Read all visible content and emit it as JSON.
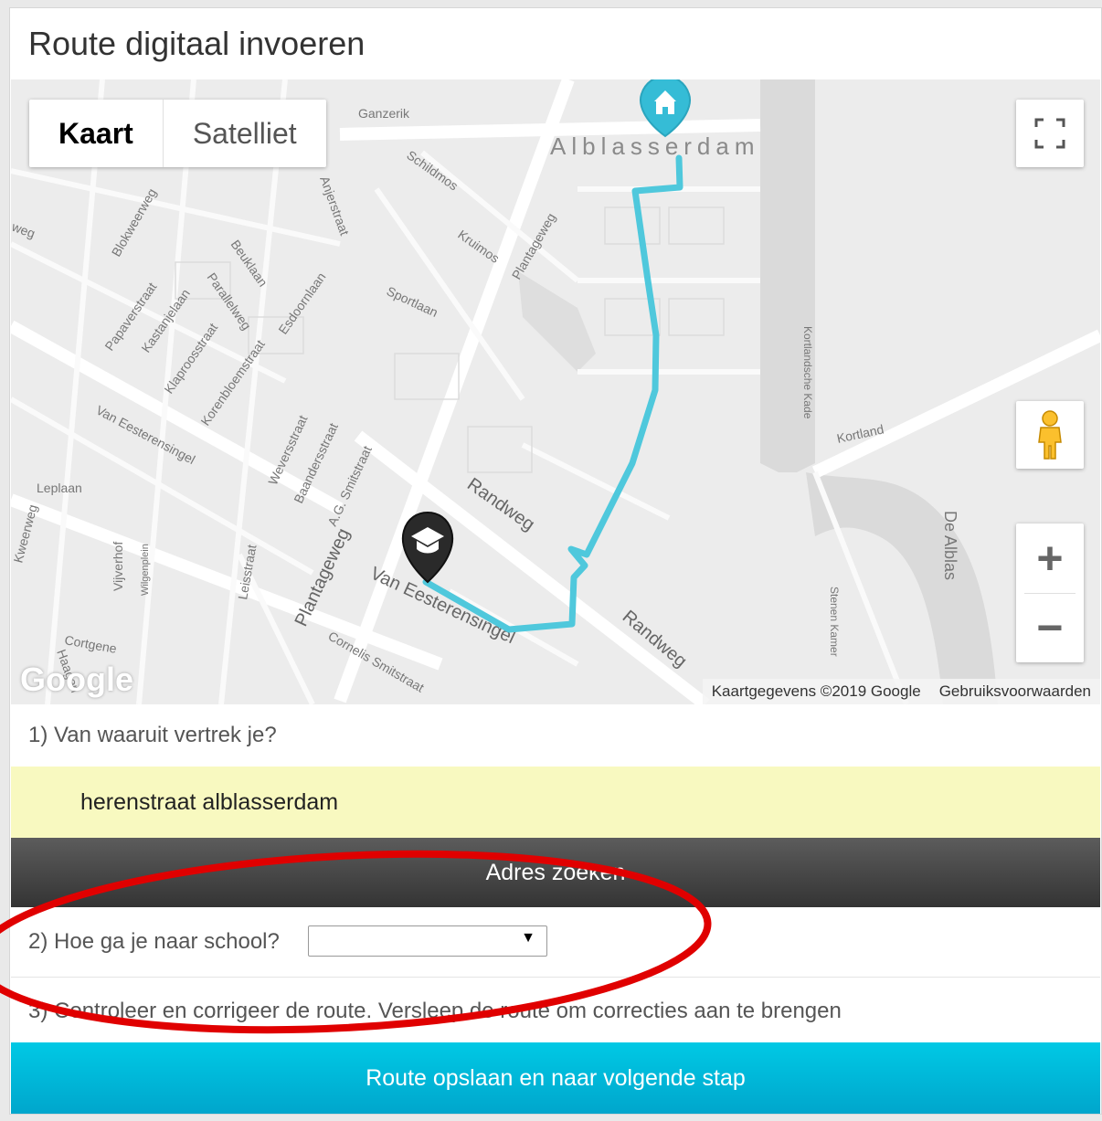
{
  "page": {
    "title": "Route digitaal invoeren"
  },
  "map": {
    "type_controls": {
      "map_label": "Kaart",
      "satellite_label": "Satelliet",
      "selected": "Kaart"
    },
    "place_label": "Alblasserdam",
    "street_labels": [
      "Ganzerik",
      "Schildmos",
      "Kruimos",
      "Plantageweg",
      "Blokweerweg",
      "Anjerstraat",
      "Beuklaan",
      "Parallelweg",
      "Papaverstraat",
      "Kastanjelaan",
      "Klaproosstraat",
      "Korenbloemstraat",
      "Esdoornlaan",
      "Sportlaan",
      "Van Eesterensingel",
      "Weversstraat",
      "Baandersstraat",
      "A.G. Smitstraat",
      "Randweg",
      "Kortlandsche Kade",
      "Kortland",
      "De Alblas",
      "Stenen Kamer",
      "Leplaan",
      "Vijverhof",
      "Wilgenplein",
      "Leisstraat",
      "Cortgene",
      "Cornelis Smitstraat",
      "Haagen",
      "weg",
      "Kweerweg"
    ],
    "markers": {
      "home": "house-icon",
      "school": "graduation-cap-icon"
    },
    "route_color": "#4fc8dc",
    "zoom_in": "+",
    "zoom_out": "−",
    "logo": "Google",
    "attribution": "Kaartgegevens ©2019 Google",
    "terms": "Gebruiksvoorwaarden"
  },
  "form": {
    "q1": "1) Van waaruit vertrek je?",
    "address_value": "herenstraat alblasserdam",
    "search_button": "Adres zoeken",
    "q2": "2) Hoe ga je naar school?",
    "select_value": "",
    "select_arrow": "▼",
    "q3": "3) Controleer en corrigeer de route. Versleep de route om correcties aan te brengen",
    "save_button": "Route opslaan en naar volgende stap"
  },
  "colors": {
    "address_bg": "#f8f9c0",
    "search_bg": "#444444",
    "save_bg": "#00b4d8",
    "annotation": "#e00000"
  }
}
